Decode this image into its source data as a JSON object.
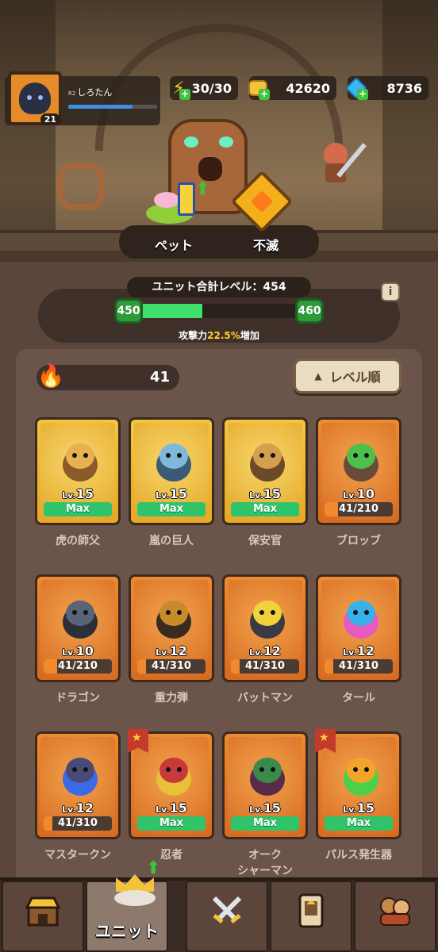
{
  "player": {
    "rank": "R2",
    "name": "しろたん",
    "level": "21",
    "xp_fraction": 0.72
  },
  "resources": {
    "energy": "30/30",
    "gold": "42620",
    "gems": "8736"
  },
  "modes": {
    "pet": "ペット",
    "immortal": "不滅"
  },
  "total": {
    "title": "ユニット合計レベル：454",
    "current_milestone": "450",
    "next_milestone": "460",
    "progress_fraction": 0.4,
    "bonus_prefix": "攻撃力",
    "bonus_value": "22.5%",
    "bonus_suffix": "増加",
    "info": "i"
  },
  "flame_count": "41",
  "sort_label": "レベル順",
  "units": [
    {
      "name": "虎の師父",
      "lv_prefix": "Lv.",
      "lv": "15",
      "status": "Max",
      "style": "gold",
      "progress": 1
    },
    {
      "name": "嵐の巨人",
      "lv_prefix": "Lv.",
      "lv": "15",
      "status": "Max",
      "style": "gold",
      "progress": 1
    },
    {
      "name": "保安官",
      "lv_prefix": "Lv.",
      "lv": "15",
      "status": "Max",
      "style": "gold",
      "progress": 1
    },
    {
      "name": "ブロッブ",
      "lv_prefix": "Lv.",
      "lv": "10",
      "status": "41/210",
      "style": "orange",
      "progress": 0.195
    },
    {
      "name": "ドラゴン",
      "lv_prefix": "Lv.",
      "lv": "10",
      "status": "41/210",
      "style": "orange",
      "progress": 0.195
    },
    {
      "name": "重力弾",
      "lv_prefix": "Lv.",
      "lv": "12",
      "status": "41/310",
      "style": "orange",
      "progress": 0.132
    },
    {
      "name": "バットマン",
      "lv_prefix": "Lv.",
      "lv": "12",
      "status": "41/310",
      "style": "orange",
      "progress": 0.132
    },
    {
      "name": "タール",
      "lv_prefix": "Lv.",
      "lv": "12",
      "status": "41/310",
      "style": "orange",
      "progress": 0.132
    },
    {
      "name": "マスタークン",
      "lv_prefix": "Lv.",
      "lv": "12",
      "status": "41/310",
      "style": "orange",
      "progress": 0.132
    },
    {
      "name": "忍者",
      "lv_prefix": "Lv.",
      "lv": "15",
      "status": "Max",
      "style": "orange",
      "progress": 1,
      "star": true
    },
    {
      "name": "オーク シャーマン",
      "lv_prefix": "Lv.",
      "lv": "15",
      "status": "Max",
      "style": "orange",
      "progress": 1
    },
    {
      "name": "パルス発生器",
      "lv_prefix": "Lv.",
      "lv": "15",
      "status": "Max",
      "style": "orange",
      "progress": 1,
      "star": true
    }
  ],
  "nav": [
    {
      "id": "shop",
      "label": "",
      "icon": "shop-icon"
    },
    {
      "id": "unit",
      "label": "ユニット",
      "icon": "crown-icon"
    },
    {
      "id": "battle",
      "label": "",
      "icon": "crossed-swords-icon"
    },
    {
      "id": "cards",
      "label": "",
      "icon": "card-icon"
    },
    {
      "id": "guild",
      "label": "",
      "icon": "guild-icon"
    }
  ],
  "colors": {
    "max_green": "#2fc46a",
    "progress_orange": "#f08a2c",
    "accent_gold": "#ffcf3a"
  }
}
